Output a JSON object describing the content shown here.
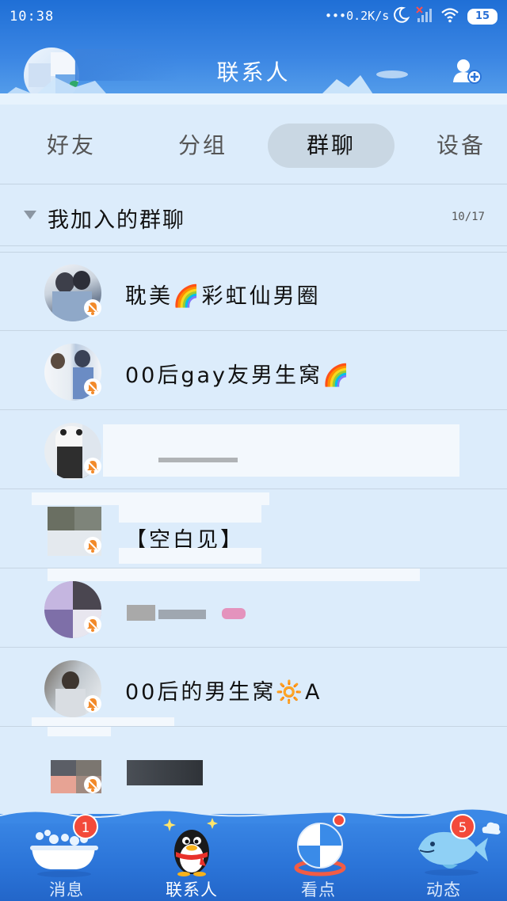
{
  "status_bar": {
    "time": "10:38",
    "network_speed": "0.2K/s",
    "battery": "15"
  },
  "header": {
    "title": "联系人",
    "add_icon": "add-contact-icon"
  },
  "tabs": [
    {
      "label": "好友",
      "active": false
    },
    {
      "label": "分组",
      "active": false
    },
    {
      "label": "群聊",
      "active": true
    },
    {
      "label": "设备",
      "active": false
    }
  ],
  "group": {
    "title": "我加入的群聊",
    "count": "10/17"
  },
  "chats": [
    {
      "name": "耽美🌈彩虹仙男圈",
      "muted": true
    },
    {
      "name": "00后gay友男生窝🌈",
      "muted": true
    },
    {
      "name": "",
      "muted": true
    },
    {
      "name": "【空白见】",
      "muted": true
    },
    {
      "name": "",
      "muted": true
    },
    {
      "name": "00后的男生窝🔆A",
      "muted": true
    },
    {
      "name": "",
      "muted": true
    }
  ],
  "bottom_nav": [
    {
      "label": "消息",
      "badge": "1",
      "icon": "bathtub-icon",
      "active": false
    },
    {
      "label": "联系人",
      "badge": "",
      "icon": "penguin-icon",
      "active": true
    },
    {
      "label": "看点",
      "badge": "",
      "icon": "ball-icon",
      "active": false
    },
    {
      "label": "动态",
      "badge": "5",
      "icon": "fish-icon",
      "active": false
    }
  ],
  "colors": {
    "header": "#2b74d8",
    "background": "#dcecfb",
    "badge": "#f34a3a"
  }
}
